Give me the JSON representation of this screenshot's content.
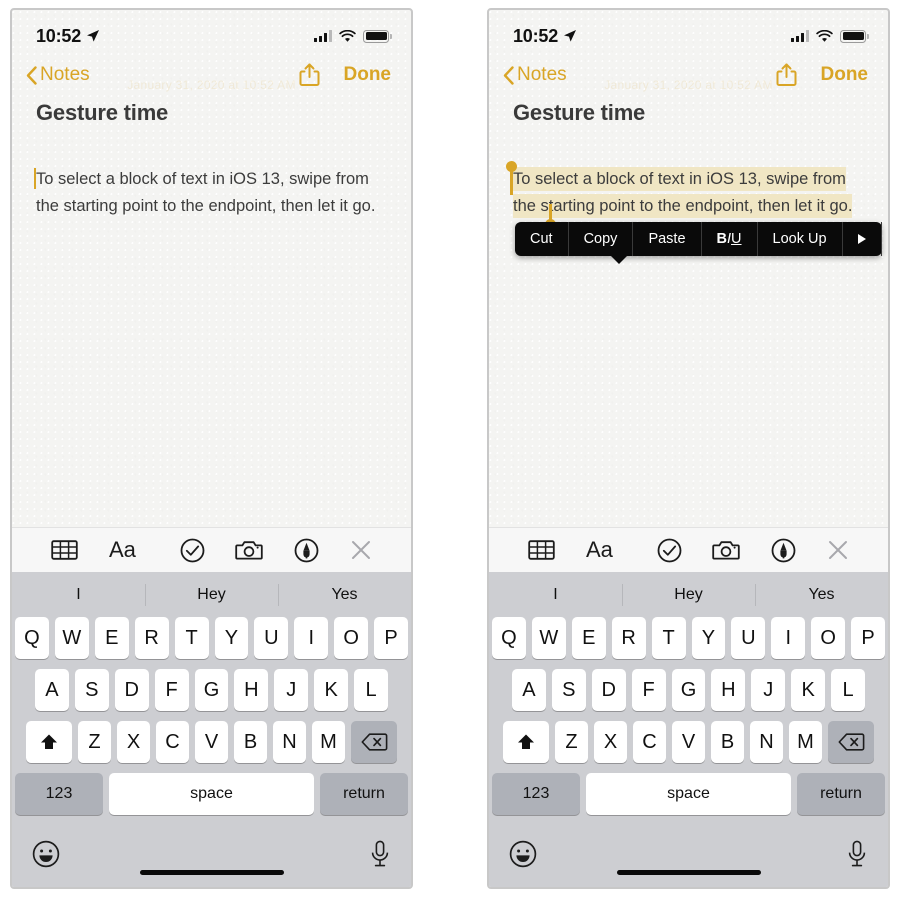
{
  "status_bar": {
    "time": "10:52",
    "location_icon": "location-arrow-icon",
    "signal_icon": "cellular-signal-icon",
    "wifi_icon": "wifi-icon",
    "battery_icon": "battery-full-icon"
  },
  "nav_bar": {
    "back_label": "Notes",
    "back_icon": "chevron-left-icon",
    "share_icon": "share-up-arrow-icon",
    "done_label": "Done",
    "ghost_date": "January 31, 2020 at 10:52 AM"
  },
  "note": {
    "title": "Gesture time",
    "body": "To select a block of text in iOS 13, swipe from the starting point to the endpoint, then let it go.",
    "selection_highlight_color": "#f0e6c4",
    "handle_color": "#d9a526",
    "accent_color": "#d9a526"
  },
  "edit_menu": {
    "items": [
      {
        "label": "Cut",
        "name": "cut"
      },
      {
        "label": "Copy",
        "name": "copy"
      },
      {
        "label": "Paste",
        "name": "paste"
      },
      {
        "label": "BIU",
        "name": "format"
      },
      {
        "label": "Look Up",
        "name": "look-up"
      },
      {
        "label": "",
        "name": "more-arrow"
      }
    ],
    "format_bold": "B",
    "format_italic": "I",
    "format_underline": "U"
  },
  "format_toolbar": {
    "items": [
      {
        "name": "table-icon",
        "label": "Table"
      },
      {
        "name": "text-format-icon",
        "label": "Aa"
      },
      {
        "name": "checklist-icon",
        "label": "Checklist"
      },
      {
        "name": "camera-icon",
        "label": "Camera"
      },
      {
        "name": "markup-pen-icon",
        "label": "Markup"
      },
      {
        "name": "close-icon",
        "label": "Close"
      }
    ]
  },
  "keyboard": {
    "suggestions": [
      "I",
      "Hey",
      "Yes"
    ],
    "row1": [
      "Q",
      "W",
      "E",
      "R",
      "T",
      "Y",
      "U",
      "I",
      "O",
      "P"
    ],
    "row2": [
      "A",
      "S",
      "D",
      "F",
      "G",
      "H",
      "J",
      "K",
      "L"
    ],
    "row3": [
      "Z",
      "X",
      "C",
      "V",
      "B",
      "N",
      "M"
    ],
    "shift_icon": "shift-up-arrow-icon",
    "backspace_icon": "backspace-delete-icon",
    "numbers_label": "123",
    "space_label": "space",
    "return_label": "return",
    "emoji_icon": "emoji-smiley-icon",
    "dictation_icon": "microphone-icon",
    "home_indicator": "home-indicator-bar"
  },
  "panels": [
    {
      "name": "left-panel",
      "state": "caret-placed"
    },
    {
      "name": "right-panel",
      "state": "text-selected-with-edit-menu"
    }
  ]
}
